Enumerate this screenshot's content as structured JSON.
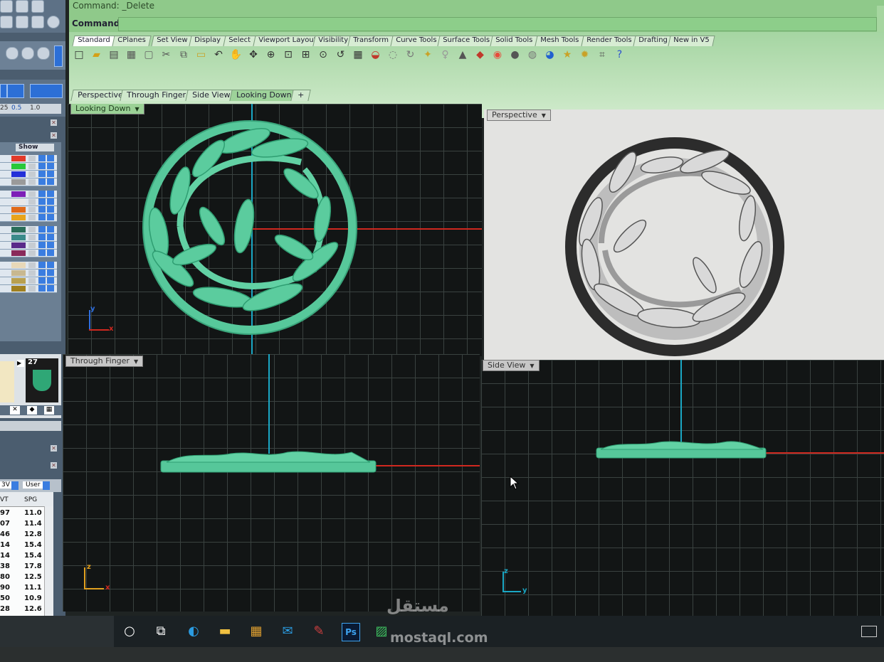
{
  "command": {
    "history": "Command: _Delete",
    "label": "Command:"
  },
  "toolbar_tabs": [
    "Standard",
    "CPlanes",
    "Set View",
    "Display",
    "Select",
    "Viewport Layout",
    "Visibility",
    "Transform",
    "Curve Tools",
    "Surface Tools",
    "Solid Tools",
    "Mesh Tools",
    "Render Tools",
    "Drafting",
    "New in V5"
  ],
  "toolbar_icons": [
    "new-icon",
    "open-icon",
    "save-icon",
    "print-icon",
    "import-icon",
    "cut-icon",
    "copy-icon",
    "paste-icon",
    "undo-icon",
    "pan-icon",
    "rotate-icon",
    "zoom-icon",
    "zoom-window-icon",
    "zoom-extents-icon",
    "zoom-selected-icon",
    "undo-view-icon",
    "four-viewports-icon",
    "car-icon",
    "hide-icon",
    "rotate-view-icon",
    "select-points-icon",
    "lightbulb-icon",
    "lock-icon",
    "layer-icon",
    "color-wheel-icon",
    "sphere-icon",
    "render-sphere-icon",
    "globe-icon",
    "render-icon",
    "settings-gear-icon",
    "options-icon",
    "help-icon"
  ],
  "viewport_tabs": [
    "Perspective",
    "Through Finger",
    "Side View",
    "Looking Down"
  ],
  "viewports": {
    "top_left": {
      "label": "Looking Down",
      "axis_v": "y",
      "axis_h": "x"
    },
    "top_right": {
      "label": "Perspective"
    },
    "bottom_left": {
      "label": "Through Finger",
      "axis_v": "z",
      "axis_h": "x"
    },
    "bottom_right": {
      "label": "Side View",
      "axis_v": "z",
      "axis_h": "y"
    }
  },
  "left_panel": {
    "show_label": "Show",
    "thumb_number": "27",
    "ruler_values": [
      "25",
      "0.5",
      "1.0"
    ],
    "dropdowns": [
      "3V",
      "User"
    ],
    "table": {
      "headers": [
        "VT",
        "SPG"
      ],
      "rows": [
        [
          "97",
          "11.0"
        ],
        [
          "07",
          "11.4"
        ],
        [
          "46",
          "12.8"
        ],
        [
          "14",
          "15.4"
        ],
        [
          "14",
          "15.4"
        ],
        [
          "38",
          "17.8"
        ],
        [
          "80",
          "12.5"
        ],
        [
          "90",
          "11.1"
        ],
        [
          "50",
          "10.9"
        ],
        [
          "28",
          "12.6"
        ]
      ]
    }
  },
  "layer_colors": [
    "#e23a2a",
    "#28c83a",
    "#2330d8",
    "#9a9a9a",
    "#7d1fb7",
    "#e8e8e8",
    "#e06a18",
    "#e8a41c",
    "#2a6e5a",
    "#3a8a8a",
    "#5a2a8a",
    "#8a2a5a",
    "#e8d8b8",
    "#c8b890",
    "#b8a050",
    "#a08020"
  ],
  "model_color": "#4fc497",
  "watermark": {
    "text": "مستقل",
    "url": "mostaql.com"
  },
  "taskbar_icons": [
    "cortana-icon",
    "task-view-icon",
    "edge-icon",
    "file-explorer-icon",
    "store-icon",
    "mail-icon",
    "paint-icon",
    "photoshop-icon",
    "rhino-icon"
  ],
  "taskbar": {
    "photoshop_label": "Ps"
  }
}
